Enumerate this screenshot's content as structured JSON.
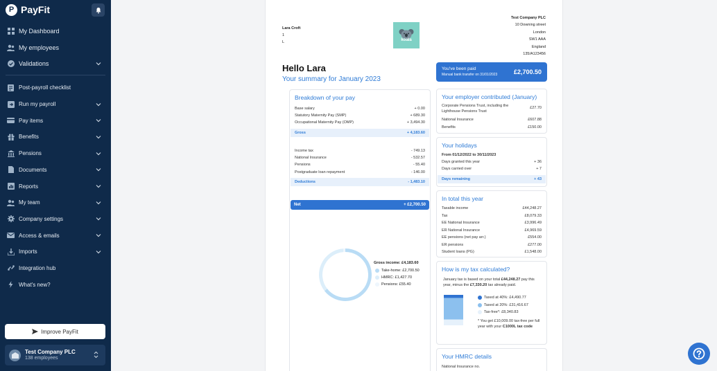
{
  "sidebar": {
    "brand": "PayFit",
    "brand_logo_letter": "P",
    "items": [
      {
        "label": "My Dashboard",
        "icon": "dashboard-icon"
      },
      {
        "label": "My employees",
        "icon": "people-icon"
      },
      {
        "label": "Validations",
        "icon": "check-circle-icon"
      },
      {
        "label": "Post-payroll checklist",
        "icon": "checklist-icon"
      },
      {
        "label": "Run my payroll",
        "icon": "arrow-box-icon"
      },
      {
        "label": "Pay items",
        "icon": "card-icon"
      },
      {
        "label": "Benefits",
        "icon": "gift-icon"
      },
      {
        "label": "Pensions",
        "icon": "bank-icon"
      },
      {
        "label": "Documents",
        "icon": "document-icon"
      },
      {
        "label": "Reports",
        "icon": "chart-icon"
      },
      {
        "label": "My team",
        "icon": "team-icon"
      },
      {
        "label": "Company settings",
        "icon": "gear-icon"
      },
      {
        "label": "Access & emails",
        "icon": "mail-icon"
      },
      {
        "label": "Imports",
        "icon": "import-icon"
      },
      {
        "label": "Integration hub",
        "icon": "integration-icon"
      },
      {
        "label": "What's new?",
        "icon": "lightning-icon"
      }
    ],
    "improve_label": "Improve PayFit",
    "company_name": "Test Company PLC",
    "company_employees": "138 employees"
  },
  "payslip": {
    "employee": {
      "name": "Lara Croft",
      "line1": "1",
      "line2": "L"
    },
    "logo_text": "koala",
    "company_address": [
      "Test Company PLC",
      "10 Downing street",
      "London",
      "SW1 AAA",
      "England",
      "135/A123456"
    ],
    "hello": "Hello Lara",
    "summary": "Your summary for January 2023",
    "paid": {
      "title": "You've been paid",
      "subtitle": "Manual bank transfer on 31/01/2023",
      "amount": "£2,700.50"
    },
    "breakdown": {
      "title": "Breakdown of your pay",
      "earnings": [
        {
          "label": "Base salary",
          "value": "+ 0.00"
        },
        {
          "label": "Statutory Maternity Pay (SMP)",
          "value": "+ 689.30"
        },
        {
          "label": "Occupational Maternity Pay (OMP)",
          "value": "+ 3,494.30"
        }
      ],
      "gross": {
        "label": "Gross",
        "value": "+ 4,183.60"
      },
      "deductions": [
        {
          "label": "Income tax",
          "value": "- 749.13"
        },
        {
          "label": "National Insurance",
          "value": "- 532.57"
        },
        {
          "label": "Pensions",
          "value": "- 55.40"
        },
        {
          "label": "Postgraduate loan repayment",
          "value": "- 146.00"
        }
      ],
      "deductions_total": {
        "label": "Deductions",
        "value": "- 1,483.10"
      },
      "net": {
        "label": "Net",
        "value": "+ £2,700.50"
      }
    },
    "chart_data": {
      "type": "pie",
      "title": "Gross income: £4,183.60",
      "slices": [
        {
          "label": "Take-home: £2,700.50",
          "value": 2700.5,
          "color": "#b9dcf5"
        },
        {
          "label": "HMRC: £1,427.70",
          "value": 1427.7,
          "color": "#dceefa"
        },
        {
          "label": "Pensions: £55.40",
          "value": 55.4,
          "color": "#eef6fd"
        }
      ]
    },
    "employer_contrib": {
      "title": "Your employer contributed (January)",
      "rows": [
        {
          "label": "Corporate Pensions Trust, including the Lighthouse Pensions Trust",
          "value": "£27.70"
        },
        {
          "label": "National Insurance",
          "value": "£607.88"
        },
        {
          "label": "Benefits",
          "value": "£150.00"
        }
      ]
    },
    "holidays": {
      "title": "Your holidays",
      "period": "From 01/12/2022 to 30/11/2023",
      "rows": [
        {
          "label": "Days granted this year",
          "value": "+ 36"
        },
        {
          "label": "Days carried over",
          "value": "+ 7"
        }
      ],
      "remaining": {
        "label": "Days remaining",
        "value": "+ 43"
      }
    },
    "total_year": {
      "title": "In total this year",
      "rows": [
        {
          "label": "Taxable income",
          "value": "£44,248.27"
        },
        {
          "label": "Tax",
          "value": "£8,079.33"
        },
        {
          "label": "EE National Insurance",
          "value": "£3,996.49"
        },
        {
          "label": "ER National Insurance",
          "value": "£4,969.59"
        },
        {
          "label": "EE pensions (net pay arr.)",
          "value": "£554.00"
        },
        {
          "label": "ER pensions",
          "value": "£277.00"
        },
        {
          "label": "Student loans (PG)",
          "value": "£1,548.00"
        }
      ]
    },
    "tax_calc": {
      "title": "How is my tax calculated?",
      "intro_1": "January tax is based on your total ",
      "intro_bold1": "£44,248.27",
      "intro_2": " pay this year, minus the ",
      "intro_bold2": "£7,330.20",
      "intro_3": " tax already paid.",
      "legend": [
        {
          "label": "Taxed at 40%: £4,490.77",
          "color": "#2f73d1",
          "value": 4490.77
        },
        {
          "label": "Taxed at 20%: £31,416.67",
          "color": "#8cc0ee",
          "value": 31416.67
        },
        {
          "label": "Tax-free*: £8,340.83",
          "color": "#e6f1fb",
          "value": 8340.83
        }
      ],
      "note_1": "* You get £10,009.00 tax-free per full year with your ",
      "note_bold": "C1000L tax code"
    },
    "hmrc": {
      "title": "Your HMRC details",
      "ni_label": "National Insurance no."
    }
  }
}
